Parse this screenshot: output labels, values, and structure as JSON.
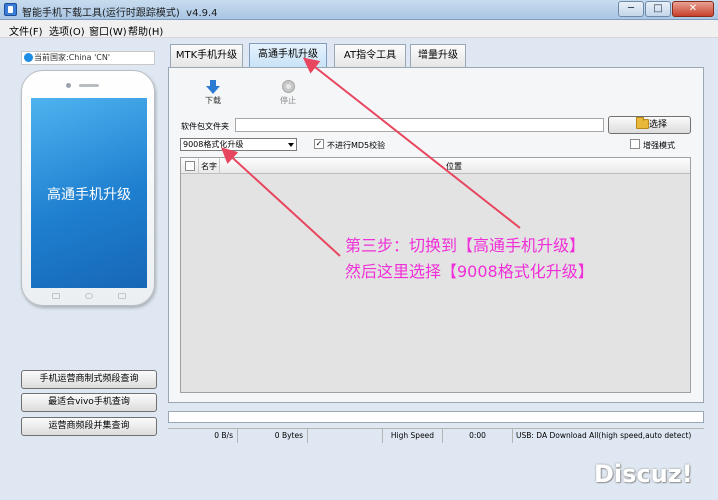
{
  "window": {
    "title": "智能手机下载工具(运行时跟踪模式)",
    "version": "v4.9.4",
    "minimize": "─",
    "maximize": "□",
    "close": "✕"
  },
  "menu": [
    "文件(F)",
    "选项(O)",
    "窗口(W)",
    "帮助(H)"
  ],
  "left": {
    "country": "当前国家:China 'CN'",
    "phone_screen_text": "高通手机升级",
    "buttons": [
      "手机运营商制式频段查询",
      "最适合vivo手机查询",
      "运营商频段并集查询"
    ]
  },
  "tabs": [
    {
      "label": "MTK手机升级",
      "active": false
    },
    {
      "label": "高通手机升级",
      "active": true
    },
    {
      "label": "AT指令工具",
      "active": false
    },
    {
      "label": "增量升级",
      "active": false
    }
  ],
  "toolbar": {
    "download": "下载",
    "stop": "停止"
  },
  "form": {
    "package_label": "软件包文件夹",
    "package_value": "",
    "browse": "选择",
    "format_select": "9008格式化升级",
    "no_md5": "不进行MD5校验",
    "no_md5_checked": true,
    "incremental": "增强模式",
    "incremental_checked": false
  },
  "list": {
    "col_name": "名字",
    "col_location": "位置"
  },
  "status": {
    "speed": "0 B/s",
    "bytes": "0 Bytes",
    "empty1": "",
    "mode": "High Speed",
    "time": "0:00",
    "usb": "USB: DA Download All(high speed,auto detect)"
  },
  "annotation": {
    "line1": "第三步：切换到【高通手机升级】",
    "line2": "然后这里选择【9008格式化升级】",
    "color": "#f02fd8"
  },
  "watermark": "Discuz!"
}
